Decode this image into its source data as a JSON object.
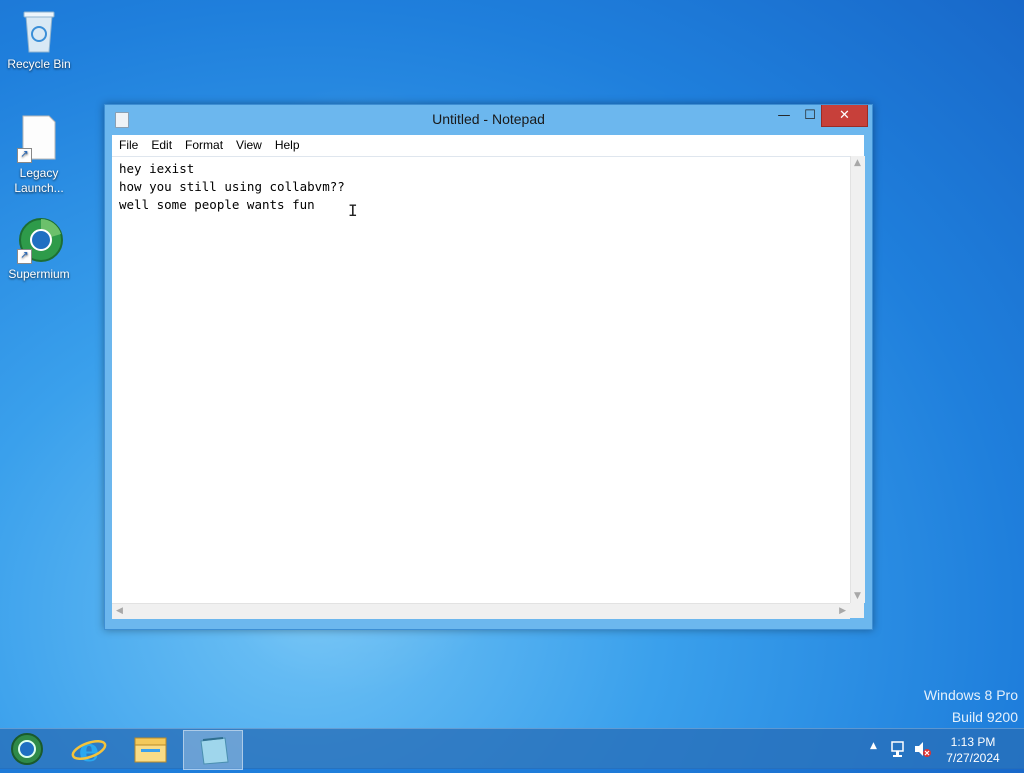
{
  "desktop": {
    "icons": [
      {
        "label": "Recycle Bin"
      },
      {
        "label": "Legacy Launch..."
      },
      {
        "label": "Supermium"
      }
    ],
    "watermark": {
      "line1": "Windows 8 Pro",
      "line2": "Build 9200"
    }
  },
  "notepad": {
    "title": "Untitled - Notepad",
    "menu": [
      "File",
      "Edit",
      "Format",
      "View",
      "Help"
    ],
    "content": "hey iexist\nhow you still using collabvm??\nwell some people wants fun "
  },
  "taskbar": {
    "clock": {
      "time": "1:13 PM",
      "date": "7/27/2024"
    },
    "pinned": [
      "supermium-icon",
      "internet-explorer-icon",
      "file-explorer-icon",
      "notepad-icon"
    ],
    "active_app": "notepad"
  },
  "colors": {
    "desktop_bg": "#1f7fdc",
    "window_frame": "#6cb7ee",
    "close_button": "#c7403a",
    "taskbar": "#286eb9"
  }
}
